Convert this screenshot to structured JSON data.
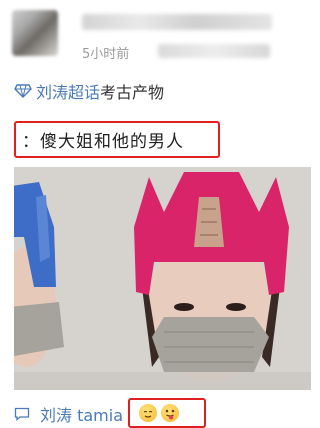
{
  "post": {
    "timestamp": "5小时前"
  },
  "topic": {
    "link_label": "刘涛超话",
    "text": "考古产物",
    "icon": "diamond-topic-icon"
  },
  "quote": {
    "text": "：傻大姐和他的男人"
  },
  "caption": {
    "icon": "comment-icon",
    "user": "刘涛 tamia",
    "emojis": [
      "sweat-smile-emoji",
      "tongue-out-emoji"
    ]
  },
  "colors": {
    "link": "#4a7ab8",
    "highlight_border": "#e02020",
    "hat_left": "#3e6dc7",
    "hat_right": "#d9246a",
    "mask": "#a6a39d"
  }
}
